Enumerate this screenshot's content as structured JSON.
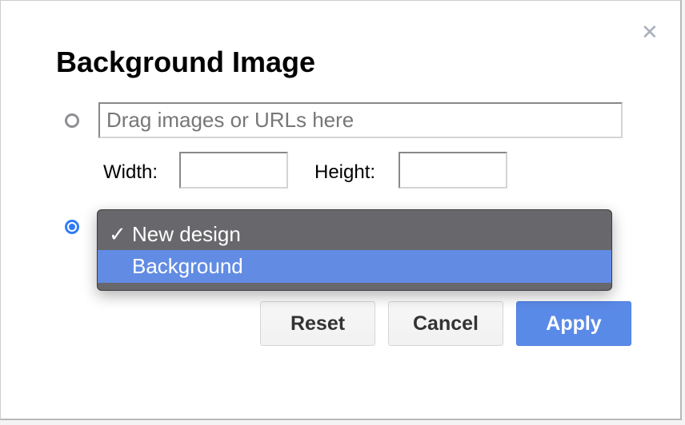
{
  "dialog": {
    "title": "Background Image",
    "close_icon": "close-x-icon",
    "url_input": {
      "placeholder": "Drag images or URLs here",
      "value": ""
    },
    "width_label": "Width:",
    "height_label": "Height:",
    "width_value": "",
    "height_value": "",
    "dropdown": {
      "options": [
        {
          "label": "New design",
          "checked": true,
          "check_mark": "✓"
        },
        {
          "label": "Background",
          "highlighted": true
        }
      ]
    },
    "buttons": {
      "reset": "Reset",
      "cancel": "Cancel",
      "apply": "Apply"
    },
    "accent_color": "#5a8ae8"
  }
}
